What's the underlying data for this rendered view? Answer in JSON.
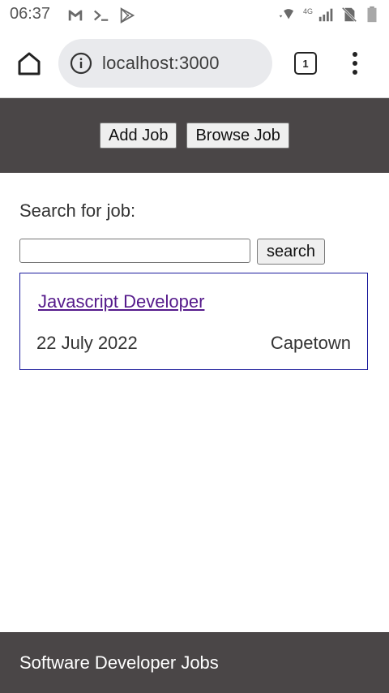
{
  "status_bar": {
    "time": "06:37",
    "left_icons": [
      "gmail-icon",
      "terminal-icon",
      "play-store-icon"
    ],
    "right_icons": [
      "wifi-icon",
      "cell-signal-icon",
      "no-sim-icon",
      "battery-icon"
    ],
    "network_label": "4G"
  },
  "browser": {
    "url": "localhost:3000",
    "tab_count": "1"
  },
  "header": {
    "add_job_label": "Add Job",
    "browse_job_label": "Browse Job"
  },
  "search": {
    "label": "Search for job:",
    "value": "",
    "button_label": "search"
  },
  "jobs": [
    {
      "title": "Javascript Developer",
      "date": "22 July 2022",
      "location": "Capetown"
    }
  ],
  "footer": {
    "text": "Software Developer Jobs"
  },
  "colors": {
    "header_bg": "#4a4647",
    "link_visited": "#551a8b",
    "card_border": "#1b1b9c"
  }
}
